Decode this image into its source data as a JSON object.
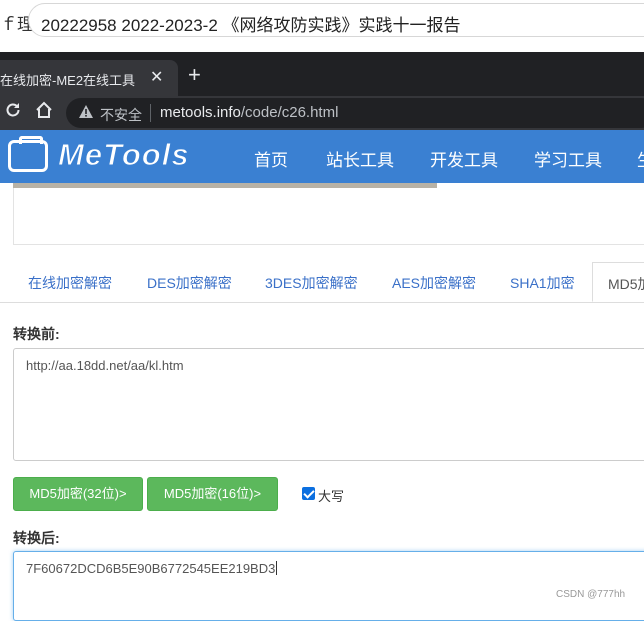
{
  "doc": {
    "prefix": "ｆ理",
    "title": "20222958 2022-2023-2 《网络攻防实践》实践十一报告"
  },
  "browser": {
    "tab_title": "在线加密-ME2在线工具",
    "tab_close": "✕",
    "new_tab": "+",
    "insecure_label": "不安全",
    "url_host": "metools.info",
    "url_path": "/code/c26.html"
  },
  "site": {
    "logo_text": "MeTools",
    "nav": [
      "首页",
      "站长工具",
      "开发工具",
      "学习工具",
      "生"
    ]
  },
  "tabs": [
    "在线加密解密",
    "DES加密解密",
    "3DES加密解密",
    "AES加密解密",
    "SHA1加密",
    "MD5加"
  ],
  "form": {
    "before_label": "转换前:",
    "input_value": "http://aa.18dd.net/aa/kl.htm",
    "btn_32": "MD5加密(32位)>",
    "btn_16": "MD5加密(16位)>",
    "uppercase_label": "大写",
    "uppercase_checked": true,
    "after_label": "转换后:",
    "output_value": "7F60672DCD6B5E90B6772545EE219BD3"
  },
  "watermark": "CSDN @777hh",
  "colors": {
    "header_blue": "#3a80d2",
    "button_green": "#5cb85c",
    "tab_link": "#3a70c8"
  }
}
